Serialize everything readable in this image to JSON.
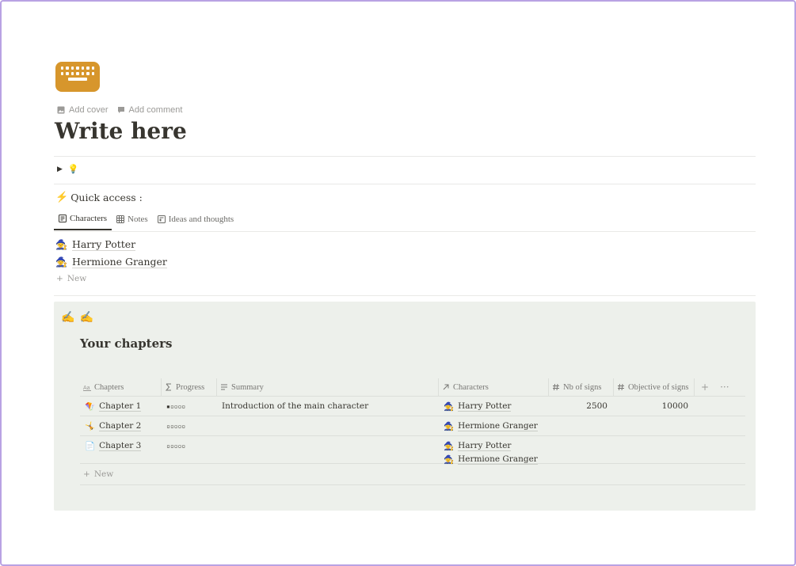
{
  "page": {
    "icon": "keyboard-icon",
    "accent_color": "#d7962c",
    "actions": {
      "add_cover": "Add cover",
      "add_comment": "Add comment"
    },
    "title": "Write here"
  },
  "toggle": {
    "icon": "💡"
  },
  "quick_access": {
    "icon": "⚡",
    "label": "Quick access :",
    "tabs": [
      {
        "label": "Characters",
        "active": true
      },
      {
        "label": "Notes",
        "active": false
      },
      {
        "label": "Ideas and thoughts",
        "active": false
      }
    ],
    "items": [
      {
        "icon": "🧙",
        "label": "Harry Potter"
      },
      {
        "icon": "🧙",
        "label": "Hermione Granger"
      }
    ],
    "new_label": "New"
  },
  "callout": {
    "icons": [
      "✍️",
      "✍️"
    ],
    "background": "#edf0eb",
    "title": "Your chapters",
    "table": {
      "columns": [
        {
          "label": "Chapters",
          "icon": "text-icon"
        },
        {
          "label": "Progress",
          "icon": "sigma-icon"
        },
        {
          "label": "Summary",
          "icon": "lines-icon"
        },
        {
          "label": "Characters",
          "icon": "relation-arrow-icon"
        },
        {
          "label": "Nb of signs",
          "icon": "hash-icon"
        },
        {
          "label": "Objective of signs",
          "icon": "hash-icon"
        }
      ],
      "add_column": "+",
      "more": "···",
      "rows": [
        {
          "icon": "🪁",
          "chapter": "Chapter 1",
          "progress": "▪▫▫▫▫",
          "summary": "Introduction of the main character",
          "characters": [
            "Harry Potter"
          ],
          "nb_signs": "2500",
          "objective": "10000"
        },
        {
          "icon": "🤸",
          "chapter": "Chapter 2",
          "progress": "▫▫▫▫▫",
          "summary": "",
          "characters": [
            "Hermione Granger"
          ],
          "nb_signs": "",
          "objective": ""
        },
        {
          "icon": "📄",
          "chapter": "Chapter 3",
          "progress": "▫▫▫▫▫",
          "summary": "",
          "characters": [
            "Harry Potter",
            "Hermione Granger"
          ],
          "nb_signs": "",
          "objective": ""
        }
      ],
      "new_label": "New"
    }
  }
}
